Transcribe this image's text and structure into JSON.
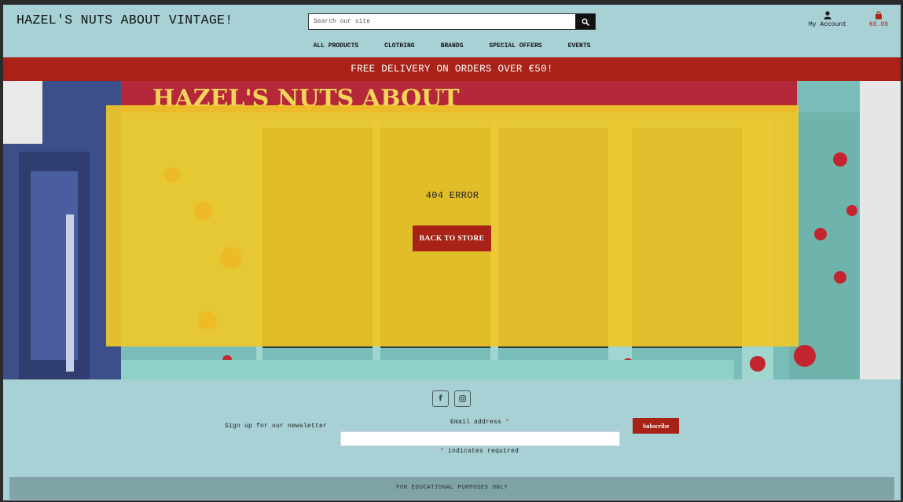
{
  "header": {
    "brand": "HAZEL'S NUTS ABOUT VINTAGE!",
    "search_placeholder": "Search our site",
    "account_label": "My Account",
    "cart_total": "€0.00"
  },
  "nav": {
    "items": [
      "ALL PRODUCTS",
      "CLOTHING",
      "BRANDS",
      "SPECIAL OFFERS",
      "EVENTS"
    ]
  },
  "banner": {
    "text": "FREE DELIVERY ON ORDERS OVER €50!"
  },
  "hero": {
    "shop_sign_text": "HAZEL'S NUTS ABOUT",
    "error_text": "404 ERROR",
    "back_button": "BACK TO STORE"
  },
  "footer": {
    "social": [
      "facebook-icon",
      "instagram-icon"
    ],
    "newsletter_label": "Sign up for our newsletter",
    "email_label": "Email address",
    "required_mark": "*",
    "required_note": "indicates required",
    "subscribe_button": "Subscribe",
    "disclaimer": "FOR EDUCATIONAL PURPOSES ONLY"
  },
  "colors": {
    "accent_red": "#a82218",
    "background_teal": "#a7d1d5",
    "panel_yellow": "#f0c828",
    "footer_bar": "#7fa3a6"
  }
}
